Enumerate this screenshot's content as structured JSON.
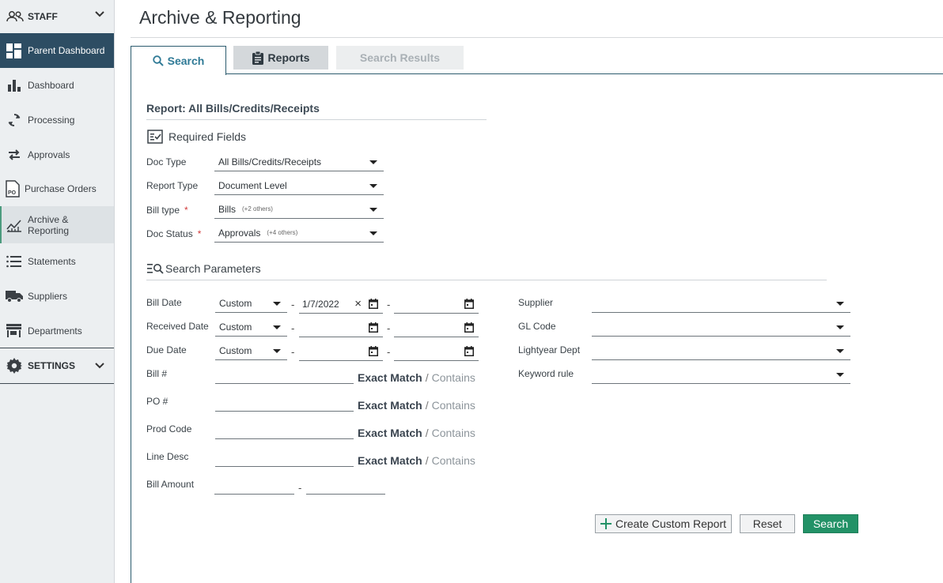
{
  "sidebar": {
    "staff_label": "STAFF",
    "items": [
      {
        "label": "Parent Dashboard"
      },
      {
        "label": "Dashboard"
      },
      {
        "label": "Processing"
      },
      {
        "label": "Approvals"
      },
      {
        "label": "Purchase Orders"
      },
      {
        "label": "Archive &\nReporting"
      },
      {
        "label": "Statements"
      },
      {
        "label": "Suppliers"
      },
      {
        "label": "Departments"
      }
    ],
    "settings_label": "SETTINGS",
    "po_badge": "PO"
  },
  "header": {
    "title": "Archive & Reporting"
  },
  "tabs": [
    {
      "label": "Search",
      "state": "active"
    },
    {
      "label": "Reports",
      "state": "enabled"
    },
    {
      "label": "Search Results",
      "state": "disabled"
    }
  ],
  "report": {
    "title": "Report: All Bills/Credits/Receipts"
  },
  "required": {
    "heading": "Required Fields",
    "doc_type": {
      "label": "Doc Type",
      "value": "All Bills/Credits/Receipts"
    },
    "report_type": {
      "label": "Report Type",
      "value": "Document Level"
    },
    "bill_type": {
      "label": "Bill type",
      "required_mark": "*",
      "value": "Bills",
      "extra": "(+2 others)"
    },
    "doc_status": {
      "label": "Doc Status",
      "required_mark": "*",
      "value": "Approvals",
      "extra": "(+4 others)"
    }
  },
  "search_params": {
    "heading": "Search Parameters",
    "range_dash": "-",
    "bill_date": {
      "label": "Bill Date",
      "mode": "Custom",
      "from": "1/7/2022",
      "to": ""
    },
    "received_date": {
      "label": "Received Date",
      "mode": "Custom",
      "from": "",
      "to": ""
    },
    "due_date": {
      "label": "Due Date",
      "mode": "Custom",
      "from": "",
      "to": ""
    },
    "text_fields": [
      {
        "label": "Bill #"
      },
      {
        "label": "PO #"
      },
      {
        "label": "Prod Code"
      },
      {
        "label": "Line Desc"
      }
    ],
    "match_exact": "Exact Match",
    "match_sep": "/",
    "match_contains": "Contains",
    "bill_amount": {
      "label": "Bill Amount"
    },
    "supplier": {
      "label": "Supplier",
      "value": ""
    },
    "gl_code": {
      "label": "GL Code",
      "value": ""
    },
    "lightyear_dept": {
      "label": "Lightyear Dept",
      "value": ""
    },
    "keyword_rule": {
      "label": "Keyword rule",
      "value": ""
    }
  },
  "buttons": {
    "custom_report": "Create Custom Report",
    "reset": "Reset",
    "search": "Search"
  },
  "colors": {
    "sidebar_active_bg": "#2d4d63",
    "accent_tab": "#2f7a96",
    "search_button": "#239267",
    "required_star": "#d13a3a"
  }
}
